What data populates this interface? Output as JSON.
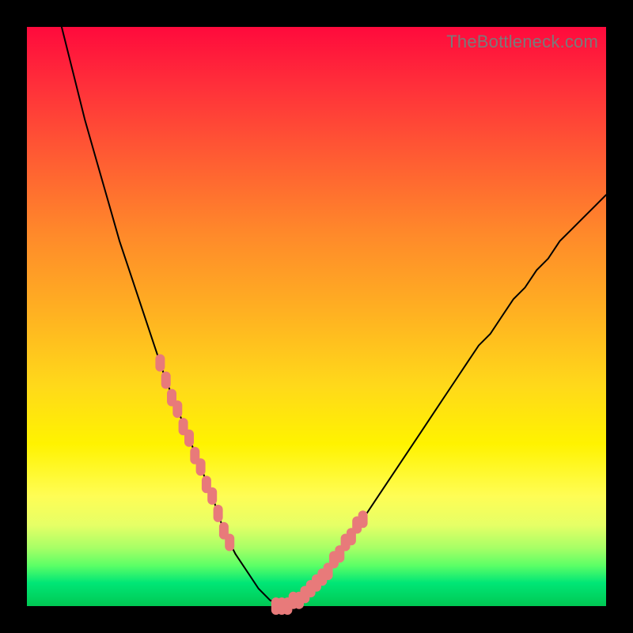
{
  "watermark": "TheBottleneck.com",
  "colors": {
    "frame": "#000000",
    "curve": "#000000",
    "marker": "#e87a7a",
    "gradient_stops": [
      "#ff0a3c",
      "#ff2f3a",
      "#ff5a33",
      "#ff8a2a",
      "#ffb321",
      "#ffd91a",
      "#fff300",
      "#fffd55",
      "#e6ff66",
      "#a6ff66",
      "#5cff66",
      "#00e676",
      "#00c853"
    ]
  },
  "chart_data": {
    "type": "line",
    "title": "",
    "xlabel": "",
    "ylabel": "",
    "xlim": [
      0,
      100
    ],
    "ylim": [
      0,
      100
    ],
    "x": [
      6,
      8,
      10,
      12,
      14,
      16,
      18,
      20,
      22,
      24,
      26,
      28,
      30,
      32,
      33,
      34,
      35,
      36,
      38,
      40,
      42,
      44,
      46,
      48,
      50,
      52,
      54,
      56,
      58,
      60,
      62,
      64,
      66,
      68,
      70,
      72,
      74,
      76,
      78,
      80,
      82,
      84,
      86,
      88,
      90,
      92,
      94,
      96,
      98,
      100
    ],
    "values": [
      100,
      92,
      84,
      77,
      70,
      63,
      57,
      51,
      45,
      39,
      34,
      29,
      24,
      19,
      16,
      13,
      11,
      9,
      6,
      3,
      1,
      0,
      0,
      1,
      3,
      6,
      9,
      12,
      15,
      18,
      21,
      24,
      27,
      30,
      33,
      36,
      39,
      42,
      45,
      47,
      50,
      53,
      55,
      58,
      60,
      63,
      65,
      67,
      69,
      71
    ],
    "markers_x": [
      23,
      24,
      25,
      26,
      27,
      28,
      29,
      30,
      31,
      32,
      33,
      34,
      35,
      43,
      44,
      45,
      46,
      47,
      48,
      49,
      50,
      51,
      52,
      53,
      54,
      55,
      56,
      57,
      58
    ],
    "markers_y": [
      42,
      39,
      36,
      34,
      31,
      29,
      26,
      24,
      21,
      19,
      16,
      13,
      11,
      0,
      0,
      0,
      1,
      1,
      2,
      3,
      4,
      5,
      6,
      8,
      9,
      11,
      12,
      14,
      15
    ]
  }
}
